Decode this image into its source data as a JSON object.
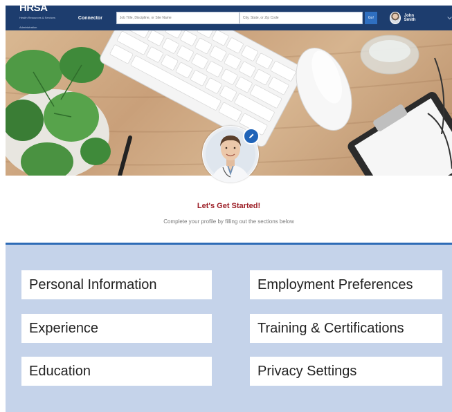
{
  "header": {
    "logo": "HRSA",
    "logo_sub": "Health Resources & Services Administration",
    "app_name": "Connector",
    "search_placeholder": "Job Title, Discipline, or Site Name",
    "location_placeholder": "City, State, or Zip Code",
    "go_label": "Go!",
    "user_name": "John Smith",
    "colors": {
      "bar": "#1d3d6e",
      "go": "#2f6fc0"
    }
  },
  "welcome": {
    "title": "Let's Get Started!",
    "subtitle": "Complete your profile by filling out the sections below"
  },
  "sections": {
    "items": [
      {
        "label": "Personal Information"
      },
      {
        "label": "Employment Preferences"
      },
      {
        "label": "Experience"
      },
      {
        "label": "Training & Certifications"
      },
      {
        "label": "Education"
      },
      {
        "label": "Privacy Settings"
      }
    ],
    "colors": {
      "background": "#c5d3ea",
      "title": "#9b1c24",
      "divider": "#2e6bb6"
    }
  },
  "icons": {
    "edit": "pencil-icon",
    "menu": "chevron-down-icon"
  }
}
